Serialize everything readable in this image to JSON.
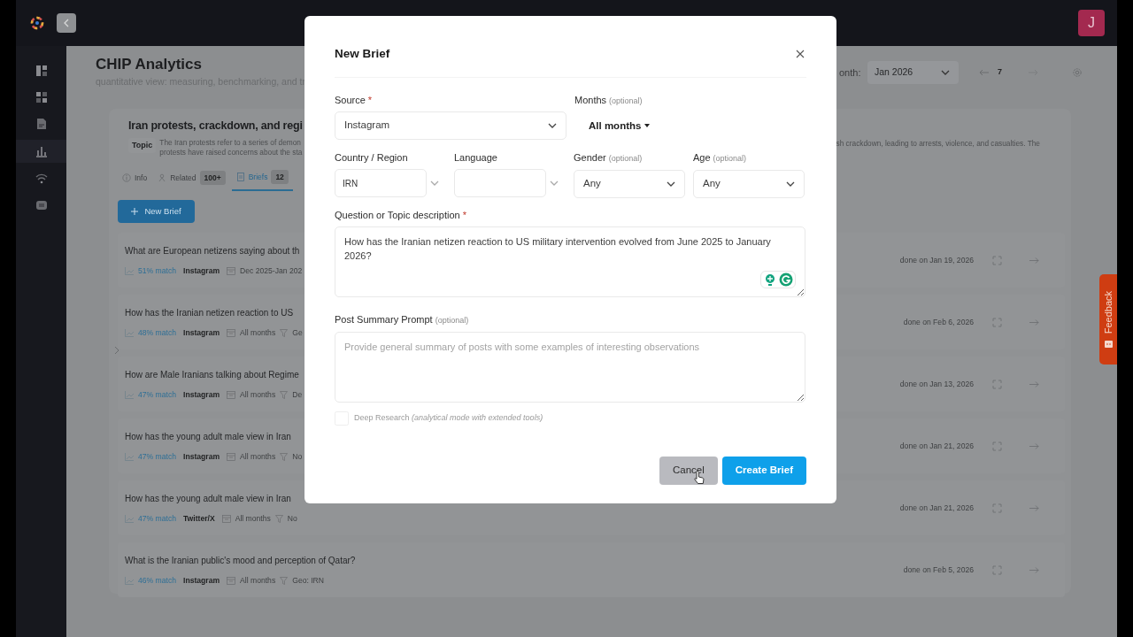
{
  "topbar": {
    "avatar": "J"
  },
  "sidebar": {
    "items": [
      {
        "kind": "layout",
        "selected": false
      },
      {
        "kind": "grid",
        "selected": false
      },
      {
        "kind": "document",
        "selected": false
      },
      {
        "kind": "chart",
        "selected": true
      },
      {
        "kind": "signal",
        "selected": false
      },
      {
        "kind": "message",
        "selected": false
      }
    ]
  },
  "header": {
    "title": "CHIP Analytics",
    "subtitle": "quantitative view: measuring, benchmarking, and tr",
    "month_label": "onth:",
    "month": "Jan 2026",
    "page": "7"
  },
  "topic": {
    "title": "Iran protests, crackdown, and regi",
    "tag": "Topic",
    "description_left": [
      "The Iran protests refer to a series of demon",
      "protests have raised concerns about the sta"
    ],
    "description_right": "sh crackdown, leading to arrests, violence, and casualties. The"
  },
  "tabs": [
    {
      "kind": "info",
      "label": "Info",
      "selected": false
    },
    {
      "kind": "related",
      "label": "Related",
      "count": "100+",
      "selected": false
    },
    {
      "kind": "briefs",
      "label": "Briefs",
      "count": "12",
      "selected": true
    }
  ],
  "new_brief_button": "New Brief",
  "briefs": [
    {
      "title": "What are European netizens saying about th",
      "match": "51% match",
      "source": "Instagram",
      "months": "Dec 2025-Jan 202",
      "done": "done on Jan 19, 2026"
    },
    {
      "title": "How has the Iranian netizen reaction to US",
      "match": "48% match",
      "source": "Instagram",
      "months": "All months",
      "filter": "Ge",
      "done": "done on Feb 6, 2026"
    },
    {
      "title": "How are Male Iranians talking about Regime",
      "match": "47% match",
      "source": "Instagram",
      "months": "All months",
      "filter": "De",
      "done": "done on Jan 13, 2026"
    },
    {
      "title": "How has the young adult male view in Iran",
      "match": "47% match",
      "source": "Instagram",
      "months": "All months",
      "filter": "No",
      "done": "done on Jan 21, 2026"
    },
    {
      "title": "How has the young adult male view in Iran",
      "match": "47% match",
      "source": "Twitter/X",
      "months": "All months",
      "filter": "No",
      "done": "done on Jan 21, 2026"
    },
    {
      "title": "What is the Iranian public's mood and perception of Qatar?",
      "match": "46% match",
      "source": "Instagram",
      "months": "All months",
      "filter": "Geo: IRN",
      "done": "done on Feb 5, 2026"
    }
  ],
  "feedback": "Feedback",
  "modal": {
    "title": "New Brief",
    "source": {
      "label": "Source",
      "mark": "*",
      "value": "Instagram"
    },
    "months": {
      "label": "Months",
      "hint": "(optional)",
      "value": "All months"
    },
    "country": {
      "label": "Country / Region",
      "value": "IRN"
    },
    "language": {
      "label": "Language"
    },
    "gender": {
      "label": "Gender",
      "hint": "(optional)",
      "value": "Any"
    },
    "age": {
      "label": "Age",
      "hint": "(optional)",
      "value": "Any"
    },
    "question": {
      "label": "Question or Topic description",
      "mark": "*",
      "value": "How has the Iranian netizen reaction to US military intervention evolved from June 2025 to January 2026?"
    },
    "summary": {
      "label": "Post Summary Prompt",
      "hint": "(optional)",
      "placeholder": "Provide general summary of posts with some examples of interesting observations"
    },
    "deep_research": {
      "label": "Deep Research *(analytical mode with extended tools)*",
      "checked": false
    },
    "buttons": [
      {
        "label": "Cancel",
        "kind": "secondary",
        "hovered": true
      },
      {
        "label": "Create Brief",
        "kind": "primary",
        "hovered": false
      }
    ]
  }
}
